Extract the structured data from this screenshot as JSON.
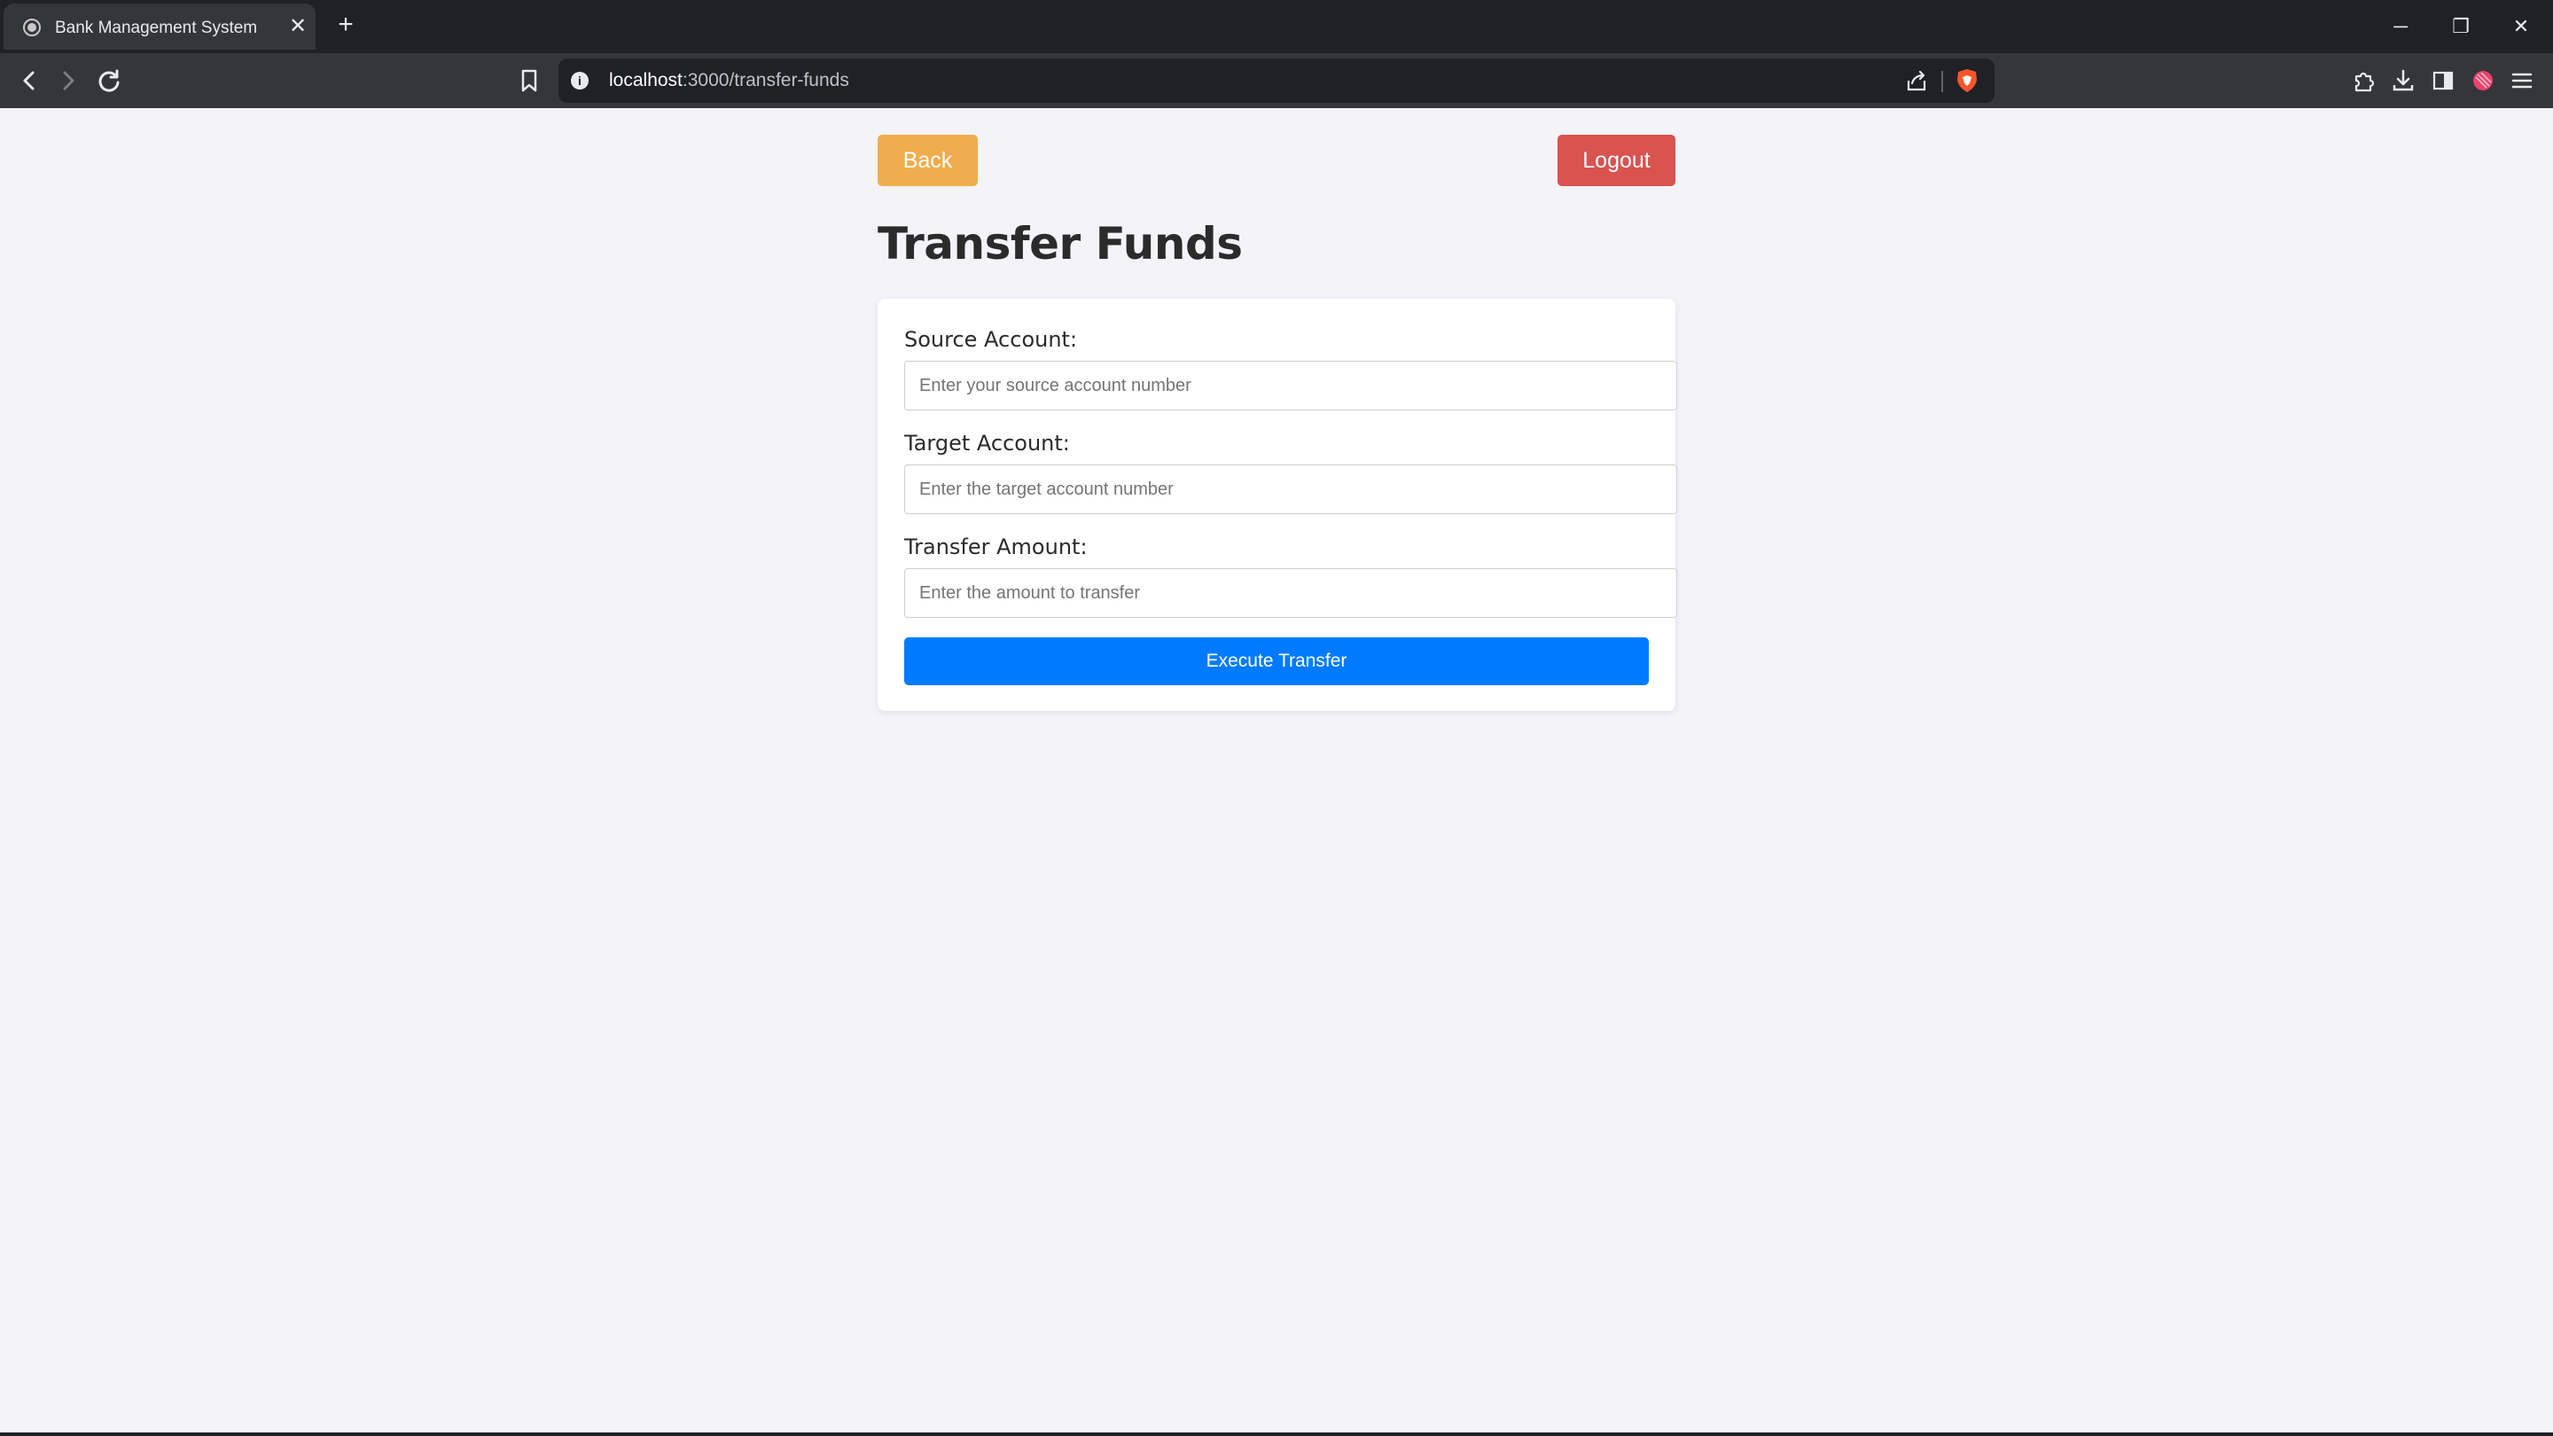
{
  "browser": {
    "tab_title": "Bank Management System",
    "tab_close": "✕",
    "new_tab": "+",
    "url_host": "localhost",
    "url_path": ":3000/transfer-funds",
    "window_controls": {
      "minimize": "─",
      "restore": "❐",
      "close": "✕"
    },
    "icons": [
      "back-icon",
      "forward-icon",
      "reload-icon",
      "bookmark-icon",
      "site-info-icon",
      "share-icon",
      "brave-shield-icon",
      "extensions-icon",
      "download-icon",
      "sidebar-icon",
      "rewards-icon",
      "menu-icon"
    ]
  },
  "header": {
    "back_label": "Back",
    "logout_label": "Logout",
    "title": "Transfer Funds"
  },
  "form": {
    "source": {
      "label": "Source Account:",
      "placeholder": "Enter your source account number",
      "value": ""
    },
    "target": {
      "label": "Target Account:",
      "placeholder": "Enter the target account number",
      "value": ""
    },
    "amount": {
      "label": "Transfer Amount:",
      "placeholder": "Enter the amount to transfer",
      "value": ""
    },
    "submit_label": "Execute Transfer"
  },
  "colors": {
    "back": "#f0ad4e",
    "logout": "#d9534f",
    "primary": "#007bff",
    "page_bg": "#f4f3f8"
  }
}
